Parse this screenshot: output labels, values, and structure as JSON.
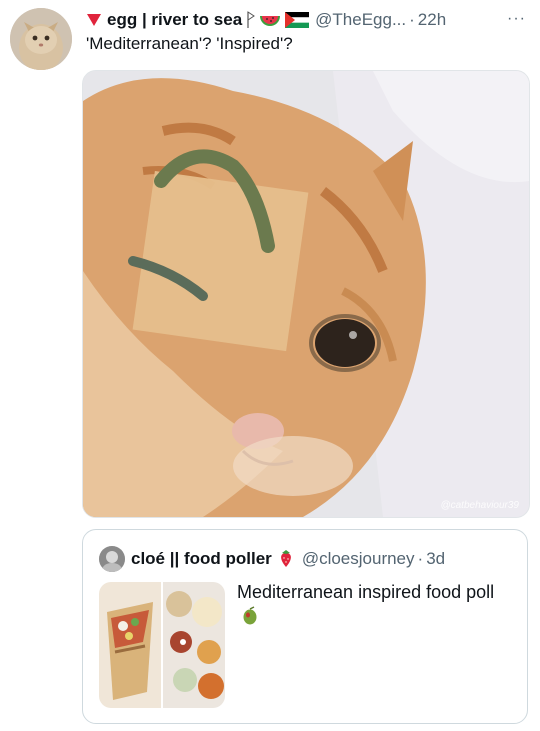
{
  "tweet": {
    "author_name": "egg | river to sea",
    "handle": "@TheEgg...",
    "dot": "·",
    "time": "22h",
    "more": "···",
    "text": "'Mediterranean'? 'Inspired'?",
    "media_watermark": "@catbehaviour39"
  },
  "quote": {
    "author_name": "cloé || food poller",
    "handle": "@cloesjourney",
    "dot": "·",
    "time": "3d",
    "text": "Mediterranean inspired food poll"
  },
  "icons": {
    "header": [
      "heart-down-icon",
      "watermelon-icon",
      "palestine-flag-icon"
    ],
    "quote": [
      "strawberry-icon",
      "olive-icon"
    ]
  },
  "colors": {
    "name": "#0f1419",
    "secondary": "#536471",
    "border": "#cfd9de"
  }
}
